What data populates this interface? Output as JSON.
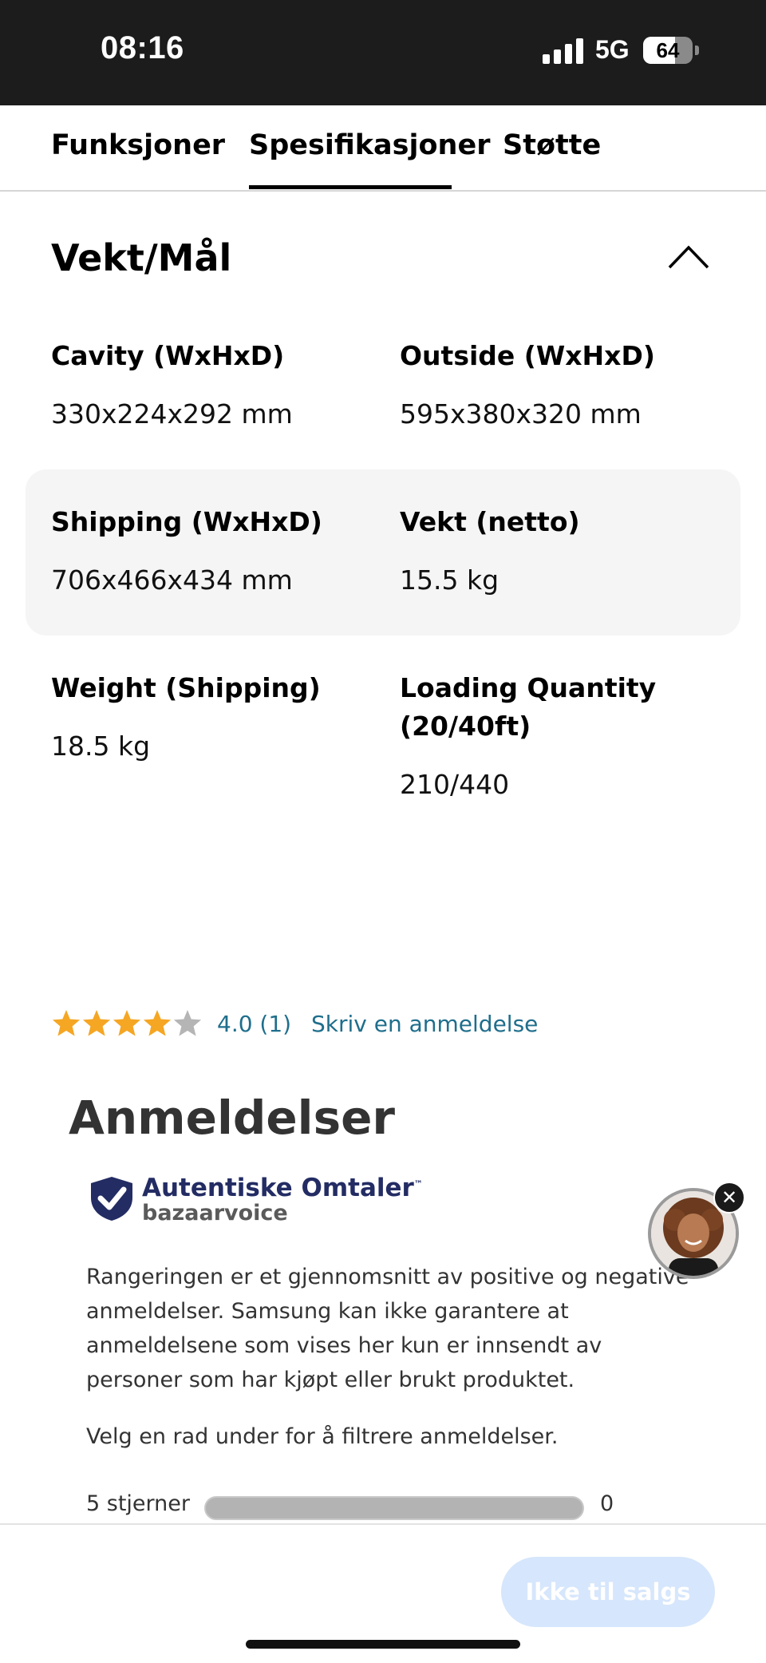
{
  "status_bar": {
    "time": "08:16",
    "network": "5G",
    "battery": "64",
    "battery_level": 0.64
  },
  "tabs": [
    {
      "label": "Funksjoner"
    },
    {
      "label": "Spesifikasjoner",
      "active": true
    },
    {
      "label": "Støtte"
    }
  ],
  "section": {
    "title": "Vekt/Mål",
    "icon": "chevron-up-icon"
  },
  "specs": [
    {
      "label": "Cavity (WxHxD)",
      "value": "330x224x292 mm"
    },
    {
      "label": "Outside (WxHxD)",
      "value": "595x380x320 mm"
    },
    {
      "label": "Shipping (WxHxD)",
      "value": "706x466x434 mm"
    },
    {
      "label": "Vekt (netto)",
      "value": "15.5 kg"
    },
    {
      "label": "Weight (Shipping)",
      "value": "18.5 kg"
    },
    {
      "label_line1": "Loading Quantity",
      "label_line2": "(20/40ft)",
      "value": "210/440"
    }
  ],
  "rating": {
    "stars": 4,
    "max": 5,
    "text": "4.0 (1)",
    "write_review": "Skriv en anmeldelse",
    "star_color": "#f5a623",
    "link_color": "#1f6e8c"
  },
  "reviews": {
    "title": "Anmeldelser",
    "badge_title": "Autentiske Omtaler",
    "badge_tm": "™",
    "badge_sub": "bazaarvoice",
    "disclaimer": "Rangeringen er et gjennomsnitt av positive og negative anmeldelser. Samsung kan ikke garantere at anmeldelsene som vises her kun er innsendt av personer som har kjøpt eller brukt produktet.",
    "filter_hint": "Velg en rad under for å filtrere anmeldelser.",
    "rows": [
      {
        "label": "5 stjerner",
        "count": "0"
      }
    ]
  },
  "chat": {
    "close": "✕",
    "avatar": "support-agent-avatar"
  },
  "cta": {
    "label": "Ikke til salgs",
    "color": "#d6e6fc"
  }
}
